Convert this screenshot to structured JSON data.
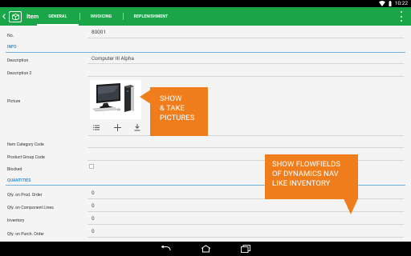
{
  "status_bar": {
    "time": "10:22"
  },
  "app_bar": {
    "title": "Item",
    "tabs": [
      "GENERAL",
      "INVOICING",
      "REPLENISHMENT"
    ]
  },
  "form": {
    "no_label": "No.",
    "no_value": "80001",
    "info_section": "INFO",
    "description_label": "Description",
    "description_value": "Computer III Alpha",
    "description2_label": "Description 2",
    "picture_label": "Picture",
    "item_category_label": "Item Category Code",
    "product_group_label": "Product Group Code",
    "blocked_label": "Blocked",
    "quantities_section": "QUANTITIES",
    "qty_prod_order_label": "Qty. on Prod. Order",
    "qty_prod_order_value": "0",
    "qty_component_label": "Qty. on Component Lines",
    "qty_component_value": "0",
    "inventory_label": "Inventory",
    "inventory_value": "0",
    "qty_purch_order_label": "Qty. on Purch. Order",
    "qty_purch_order_value": "0"
  },
  "callouts": {
    "pictures": "SHOW\n& TAKE\nPICTURES",
    "flowfields": "SHOW FLOWFIELDS\nOF DYNAMICS NAV\nLIKE INVENTORY"
  },
  "colors": {
    "app_bar": "#1aa549",
    "section": "#2f8fd1",
    "callout": "#f07d1b"
  },
  "icons": {
    "app": "item-icon",
    "picture_tools": [
      "list-icon",
      "add-icon",
      "download-icon"
    ],
    "nav": [
      "back-icon",
      "home-icon",
      "recents-icon"
    ]
  }
}
